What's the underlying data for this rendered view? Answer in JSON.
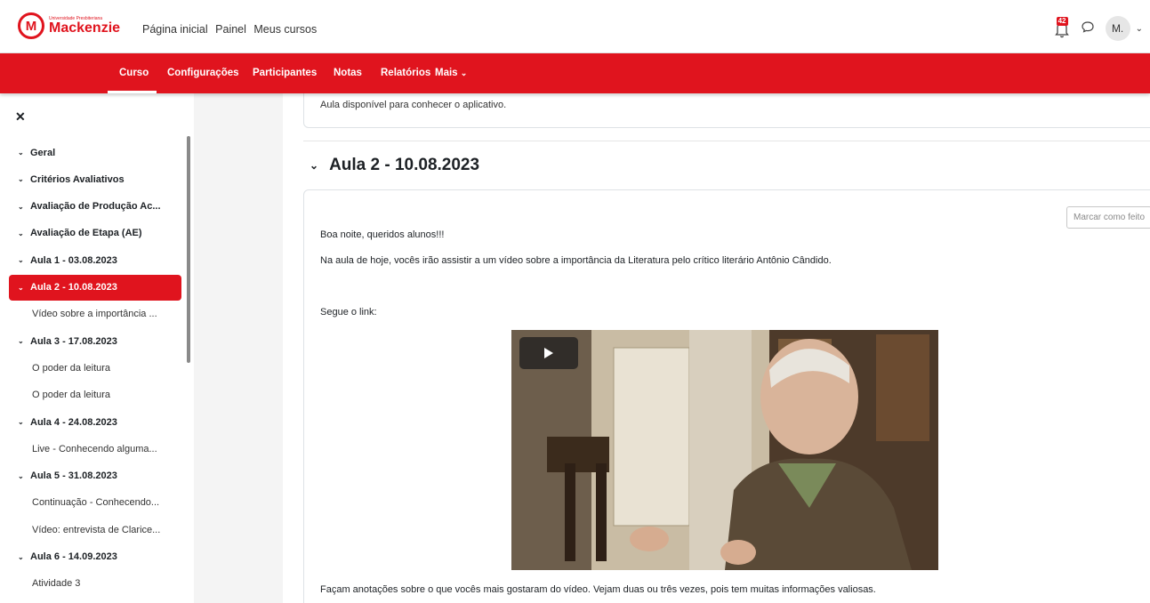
{
  "brand": {
    "logo_letter": "M",
    "logo_small": "Universidade Presbiteriana",
    "logo_big": "Mackenzie",
    "color": "#e0141e"
  },
  "topnav": {
    "items": [
      "Página inicial",
      "Painel",
      "Meus cursos"
    ]
  },
  "user": {
    "notification_count": "42",
    "avatar_initial": "M."
  },
  "course_nav": {
    "items": [
      "Curso",
      "Configurações",
      "Participantes",
      "Notas",
      "Relatórios",
      "Mais"
    ],
    "active": "Curso"
  },
  "sidebar": {
    "items": [
      {
        "label": "Geral",
        "type": "section"
      },
      {
        "label": "Critérios Avaliativos",
        "type": "section"
      },
      {
        "label": "Avaliação de Produção Ac...",
        "type": "section"
      },
      {
        "label": "Avaliação de Etapa (AE)",
        "type": "section"
      },
      {
        "label": "Aula 1 - 03.08.2023",
        "type": "section"
      },
      {
        "label": "Aula 2 - 10.08.2023",
        "type": "section",
        "active": true
      },
      {
        "label": "Vídeo sobre a importância ...",
        "type": "child"
      },
      {
        "label": "Aula 3 - 17.08.2023",
        "type": "section"
      },
      {
        "label": "O poder da leitura",
        "type": "child"
      },
      {
        "label": "O poder da leitura",
        "type": "child"
      },
      {
        "label": "Aula 4 - 24.08.2023",
        "type": "section"
      },
      {
        "label": "Live - Conhecendo alguma...",
        "type": "child"
      },
      {
        "label": "Aula 5 - 31.08.2023",
        "type": "section"
      },
      {
        "label": "Continuação - Conhecendo...",
        "type": "child"
      },
      {
        "label": "Vídeo: entrevista de Clarice...",
        "type": "child"
      },
      {
        "label": "Aula 6 - 14.09.2023",
        "type": "section"
      },
      {
        "label": "Atividade 3",
        "type": "child"
      }
    ]
  },
  "content": {
    "prev_text": "Aula disponível para conhecer o aplicativo.",
    "section_title": "Aula 2 - 10.08.2023",
    "mark_done": "Marcar como feito",
    "greeting": "Boa noite, queridos alunos!!!",
    "intro": "Na aula de hoje, vocês irão assistir a um vídeo sobre a importância da Literatura pelo crítico literário Antônio Cândido.",
    "link_label": "Segue o link:",
    "footer_text": "Façam anotações sobre o que vocês mais gostaram do vídeo. Vejam duas ou três vezes, pois tem muitas informações valiosas."
  }
}
